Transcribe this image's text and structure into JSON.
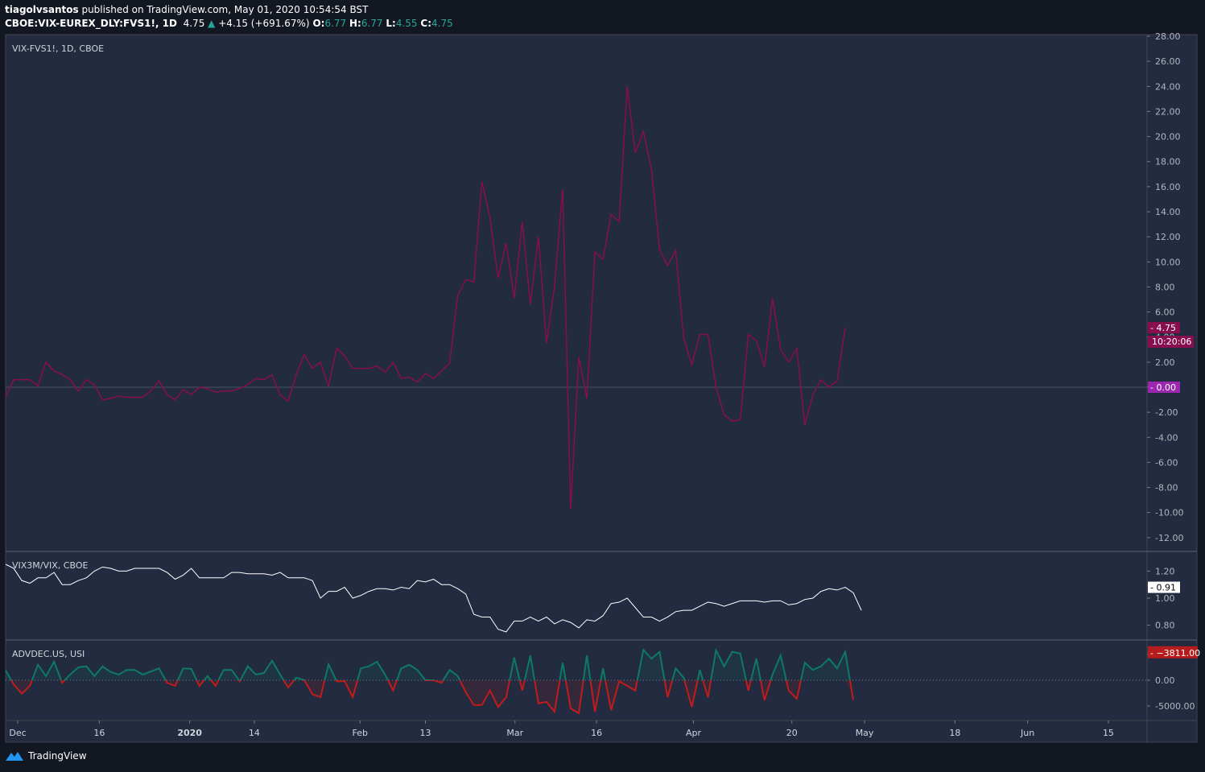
{
  "header": {
    "author": "tiagolvsantos",
    "published": "published on TradingView.com, May 01, 2020 10:54:54 BST",
    "symbol": "CBOE:VIX-EUREX_DLY:FVS1!, 1D",
    "last": "4.75",
    "change": "+4.15 (+691.67%)",
    "o_label": "O:",
    "o": "6.77",
    "h_label": "H:",
    "h": "6.77",
    "l_label": "L:",
    "l": "4.55",
    "c_label": "C:",
    "c": "4.75"
  },
  "footer": {
    "brand": "TradingView"
  },
  "colors": {
    "main": "#880e4f",
    "ratio": "#ffffff",
    "adv_up": "#0e7a63",
    "adv_down": "#c21b1b",
    "pane_bg": "#222b40",
    "zero_badge": "#9c27b0"
  },
  "chart_data": [
    {
      "type": "line",
      "title": "VIX-FVS1!, 1D, CBOE",
      "ylim": [
        -13,
        28
      ],
      "yticks": [
        "28.00",
        "26.00",
        "24.00",
        "22.00",
        "20.00",
        "18.00",
        "16.00",
        "14.00",
        "12.00",
        "10.00",
        "8.00",
        "6.00",
        "4.00",
        "2.00",
        "0.00",
        "-2.00",
        "-4.00",
        "-6.00",
        "-8.00",
        "-10.00",
        "-12.00"
      ],
      "last_label": "4.75",
      "countdown": "10:20:06",
      "zero_label": "0.00",
      "values": [
        -0.8,
        0.6,
        0.6,
        0.6,
        0.1,
        2.0,
        1.3,
        1.0,
        0.6,
        -0.3,
        0.6,
        0.2,
        -1.0,
        -0.9,
        -0.7,
        -0.8,
        -0.8,
        -0.8,
        -0.3,
        0.5,
        -0.6,
        -1.0,
        -0.2,
        -0.6,
        0.0,
        -0.1,
        -0.4,
        -0.3,
        -0.3,
        -0.1,
        0.2,
        0.7,
        0.6,
        1.0,
        -0.6,
        -1.1,
        1.0,
        2.6,
        1.5,
        2.0,
        0.1,
        3.1,
        2.5,
        1.5,
        1.5,
        1.5,
        1.7,
        1.2,
        2.0,
        0.7,
        0.8,
        0.4,
        1.1,
        0.7,
        1.3,
        1.9,
        7.3,
        8.6,
        8.4,
        16.4,
        13.5,
        8.7,
        11.5,
        7.1,
        13.2,
        6.6,
        12.0,
        3.5,
        8.1,
        15.8,
        -9.7,
        2.4,
        -0.9,
        10.8,
        10.2,
        13.8,
        13.2,
        24.0,
        18.7,
        20.4,
        17.4,
        11.0,
        9.7,
        10.9,
        3.9,
        1.8,
        4.2,
        4.2,
        0.0,
        -2.2,
        -2.7,
        -2.6,
        4.2,
        3.7,
        1.6,
        7.1,
        3.0,
        2.0,
        3.1,
        -3.0,
        -0.6,
        0.6,
        0.0,
        0.5,
        4.75
      ]
    },
    {
      "type": "line",
      "title": "VIX3M/VIX, CBOE",
      "ylim": [
        0.7,
        1.31
      ],
      "yticks": [
        "1.20",
        "1.00",
        "0.80"
      ],
      "last_label": "0.91",
      "values": [
        1.25,
        1.22,
        1.13,
        1.11,
        1.15,
        1.15,
        1.19,
        1.1,
        1.1,
        1.13,
        1.15,
        1.2,
        1.23,
        1.22,
        1.2,
        1.2,
        1.22,
        1.22,
        1.22,
        1.22,
        1.19,
        1.14,
        1.17,
        1.22,
        1.15,
        1.15,
        1.15,
        1.15,
        1.19,
        1.19,
        1.18,
        1.18,
        1.18,
        1.17,
        1.19,
        1.15,
        1.15,
        1.15,
        1.13,
        1.0,
        1.05,
        1.05,
        1.08,
        1.0,
        1.02,
        1.05,
        1.07,
        1.07,
        1.06,
        1.08,
        1.07,
        1.13,
        1.12,
        1.14,
        1.1,
        1.1,
        1.07,
        1.03,
        0.88,
        0.86,
        0.86,
        0.77,
        0.75,
        0.83,
        0.83,
        0.86,
        0.83,
        0.86,
        0.81,
        0.84,
        0.82,
        0.78,
        0.84,
        0.83,
        0.87,
        0.96,
        0.97,
        1.0,
        0.93,
        0.86,
        0.86,
        0.83,
        0.86,
        0.9,
        0.91,
        0.91,
        0.94,
        0.97,
        0.96,
        0.94,
        0.96,
        0.98,
        0.98,
        0.98,
        0.97,
        0.98,
        0.98,
        0.95,
        0.96,
        0.99,
        1.0,
        1.05,
        1.07,
        1.06,
        1.08,
        1.04,
        0.91
      ]
    },
    {
      "type": "line",
      "title": "ADVDEC.US, USI",
      "ylim": [
        -7300,
        7500
      ],
      "yticks": [
        "5000.00",
        "0.00",
        "-5000.00"
      ],
      "last_label": "−3811.00",
      "values": [
        1900,
        -800,
        -2600,
        -1100,
        3000,
        800,
        3600,
        -500,
        1100,
        2500,
        2700,
        800,
        2700,
        1600,
        1100,
        2000,
        2000,
        1100,
        1700,
        2300,
        -500,
        -1100,
        2300,
        2200,
        -1100,
        800,
        -1100,
        2000,
        2000,
        -200,
        2700,
        1100,
        1400,
        3800,
        1100,
        -1400,
        500,
        0,
        -2700,
        -3300,
        3100,
        -200,
        -200,
        -3300,
        2300,
        2700,
        3600,
        1100,
        -2000,
        2300,
        3000,
        2000,
        0,
        0,
        -500,
        2000,
        800,
        -2300,
        -4800,
        -4800,
        -2000,
        -5200,
        -3300,
        4400,
        -2000,
        4800,
        -4500,
        -4200,
        -6100,
        3400,
        -5500,
        -6400,
        4800,
        -6100,
        2300,
        -5800,
        -200,
        -1100,
        -2000,
        5900,
        4200,
        5500,
        -3300,
        2300,
        500,
        -5200,
        2000,
        -3300,
        5800,
        2700,
        5500,
        5200,
        -2000,
        4200,
        -3900,
        1100,
        4800,
        -2000,
        -3600,
        3400,
        2000,
        2700,
        4200,
        2300,
        5500,
        -3811
      ]
    }
  ],
  "xaxis": {
    "ticks": [
      {
        "label": "Dec",
        "i": 1.5
      },
      {
        "label": "16",
        "i": 11.6
      },
      {
        "label": "2020",
        "i": 22.8,
        "bold": true
      },
      {
        "label": "14",
        "i": 30.8
      },
      {
        "label": "Feb",
        "i": 43.9
      },
      {
        "label": "13",
        "i": 52
      },
      {
        "label": "Mar",
        "i": 63.1
      },
      {
        "label": "16",
        "i": 73.2
      },
      {
        "label": "Apr",
        "i": 85.2
      },
      {
        "label": "20",
        "i": 97.4
      },
      {
        "label": "May",
        "i": 106.4
      },
      {
        "label": "18",
        "i": 117.6
      },
      {
        "label": "Jun",
        "i": 126.6
      },
      {
        "label": "15",
        "i": 136.6
      }
    ]
  }
}
